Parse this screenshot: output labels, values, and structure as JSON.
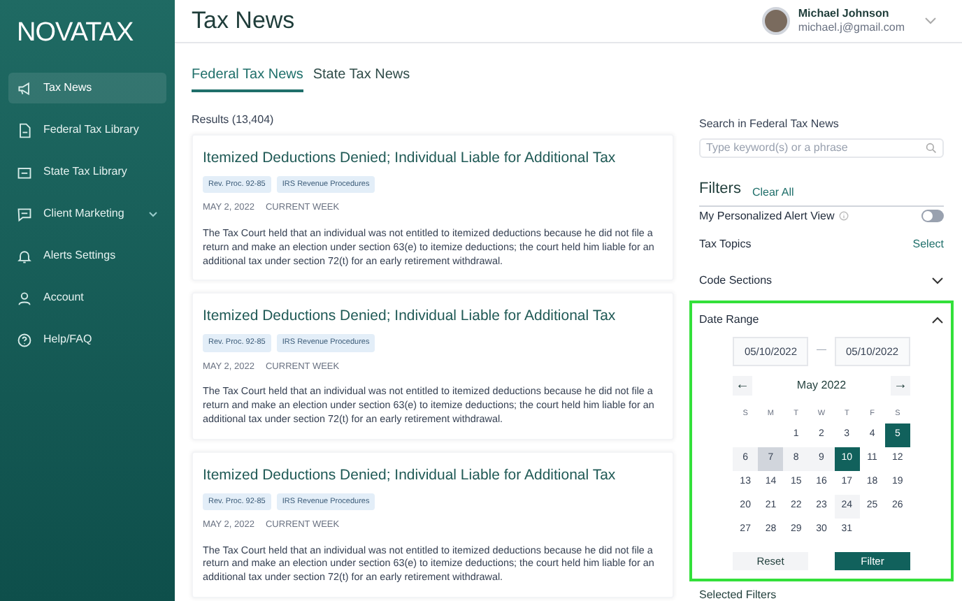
{
  "logo": "NOVATAX",
  "sidebar": {
    "items": [
      {
        "label": "Tax News",
        "selected": true,
        "expandable": false
      },
      {
        "label": "Federal Tax Library",
        "selected": false,
        "expandable": false
      },
      {
        "label": "State Tax Library",
        "selected": false,
        "expandable": false
      },
      {
        "label": "Client Marketing",
        "selected": false,
        "expandable": true
      },
      {
        "label": "Alerts Settings",
        "selected": false,
        "expandable": false
      },
      {
        "label": "Account",
        "selected": false,
        "expandable": false
      },
      {
        "label": "Help/FAQ",
        "selected": false,
        "expandable": false
      }
    ]
  },
  "header": {
    "title": "Tax News",
    "user": {
      "name": "Michael Johnson",
      "email": "michael.j@gmail.com"
    }
  },
  "tabs": [
    {
      "label": "Federal Tax News",
      "selected": true
    },
    {
      "label": "State Tax News",
      "selected": false
    }
  ],
  "results_label": "Results (13,404)",
  "articles": [
    {
      "title": "Itemized Deductions Denied; Individual Liable for Additional Tax",
      "tags": [
        "Rev. Proc. 92-85",
        "IRS Revenue Procedures"
      ],
      "date": "MAY 2, 2022",
      "period": "CURRENT WEEK",
      "summary": "The Tax Court held that an individual was not entitled to itemized deductions because he did not file a return and make an election under section 63(e) to itemize deductions; the court held him liable for an additional tax under section 72(t) for an early retirement withdrawal."
    },
    {
      "title": "Itemized Deductions Denied; Individual Liable for Additional Tax",
      "tags": [
        "Rev. Proc. 92-85",
        "IRS Revenue Procedures"
      ],
      "date": "MAY 2, 2022",
      "period": "CURRENT WEEK",
      "summary": "The Tax Court held that an individual was not entitled to itemized deductions because he did not file a return and make an election under section 63(e) to itemize deductions; the court held him liable for an additional tax under section 72(t) for an early retirement withdrawal."
    },
    {
      "title": "Itemized Deductions Denied; Individual Liable for Additional Tax",
      "tags": [
        "Rev. Proc. 92-85",
        "IRS Revenue Procedures"
      ],
      "date": "MAY 2, 2022",
      "period": "CURRENT WEEK",
      "summary": "The Tax Court held that an individual was not entitled to itemized deductions because he did not file a return and make an election under section 63(e) to itemize deductions; the court held him liable for an additional tax under section 72(t) for an early retirement withdrawal."
    }
  ],
  "search": {
    "label": "Search in Federal Tax News",
    "placeholder": "Type keyword(s) or a phrase"
  },
  "filters": {
    "title": "Filters",
    "clear_label": "Clear All",
    "alert_view": {
      "label": "My Personalized Alert View",
      "on": false
    },
    "sections": [
      {
        "label": "Tax Topics",
        "kind": "select",
        "action": "Select"
      },
      {
        "label": "Code Sections",
        "kind": "collapsible",
        "expanded": false
      }
    ],
    "date_range": {
      "label": "Date Range",
      "expanded": true,
      "highlighted": true,
      "from": "05/10/2022",
      "separator": "—",
      "to": "05/10/2022",
      "month": "May 2022",
      "prev": "←",
      "next": "→",
      "weekdays": [
        "S",
        "M",
        "T",
        "W",
        "T",
        "F",
        "S"
      ],
      "weeks": [
        [
          {
            "day": "1",
            "selected": false,
            "in_range": false,
            "hovered": false,
            "today": false
          },
          {
            "day": "2",
            "selected": false,
            "in_range": false,
            "hovered": false,
            "today": false
          },
          {
            "day": "3",
            "selected": false,
            "in_range": false,
            "hovered": false,
            "today": false
          },
          {
            "day": "4",
            "selected": false,
            "in_range": false,
            "hovered": false,
            "today": false
          },
          {
            "day": "5",
            "selected": true,
            "in_range": false,
            "hovered": false,
            "today": false
          }
        ],
        [
          {
            "day": "6",
            "selected": false,
            "in_range": true,
            "hovered": false,
            "today": false
          },
          {
            "day": "7",
            "selected": false,
            "in_range": true,
            "hovered": true,
            "today": false
          },
          {
            "day": "8",
            "selected": false,
            "in_range": true,
            "hovered": false,
            "today": false
          },
          {
            "day": "9",
            "selected": false,
            "in_range": true,
            "hovered": false,
            "today": false
          },
          {
            "day": "10",
            "selected": true,
            "in_range": false,
            "hovered": false,
            "today": false
          },
          {
            "day": "11",
            "selected": false,
            "in_range": false,
            "hovered": false,
            "today": false
          },
          {
            "day": "12",
            "selected": false,
            "in_range": false,
            "hovered": false,
            "today": false
          }
        ],
        [
          {
            "day": "13",
            "selected": false,
            "in_range": false,
            "hovered": false,
            "today": false
          },
          {
            "day": "14",
            "selected": false,
            "in_range": false,
            "hovered": false,
            "today": false
          },
          {
            "day": "15",
            "selected": false,
            "in_range": false,
            "hovered": false,
            "today": false
          },
          {
            "day": "16",
            "selected": false,
            "in_range": false,
            "hovered": false,
            "today": false
          },
          {
            "day": "17",
            "selected": false,
            "in_range": false,
            "hovered": false,
            "today": false
          },
          {
            "day": "18",
            "selected": false,
            "in_range": false,
            "hovered": false,
            "today": false
          },
          {
            "day": "19",
            "selected": false,
            "in_range": false,
            "hovered": false,
            "today": false
          }
        ],
        [
          {
            "day": "20",
            "selected": false,
            "in_range": false,
            "hovered": false,
            "today": false
          },
          {
            "day": "21",
            "selected": false,
            "in_range": false,
            "hovered": false,
            "today": false
          },
          {
            "day": "22",
            "selected": false,
            "in_range": false,
            "hovered": false,
            "today": false
          },
          {
            "day": "23",
            "selected": false,
            "in_range": false,
            "hovered": false,
            "today": false
          },
          {
            "day": "24",
            "selected": false,
            "in_range": false,
            "hovered": false,
            "today": true
          },
          {
            "day": "25",
            "selected": false,
            "in_range": false,
            "hovered": false,
            "today": false
          },
          {
            "day": "26",
            "selected": false,
            "in_range": false,
            "hovered": false,
            "today": false
          }
        ],
        [
          {
            "day": "27",
            "selected": false,
            "in_range": false,
            "hovered": false,
            "today": false
          },
          {
            "day": "28",
            "selected": false,
            "in_range": false,
            "hovered": false,
            "today": false
          },
          {
            "day": "29",
            "selected": false,
            "in_range": false,
            "hovered": false,
            "today": false
          },
          {
            "day": "30",
            "selected": false,
            "in_range": false,
            "hovered": false,
            "today": false
          },
          {
            "day": "31",
            "selected": false,
            "in_range": false,
            "hovered": false,
            "today": false
          }
        ]
      ],
      "reset_label": "Reset",
      "filter_label": "Filter"
    },
    "selected_filters_label": "Selected Filters"
  }
}
